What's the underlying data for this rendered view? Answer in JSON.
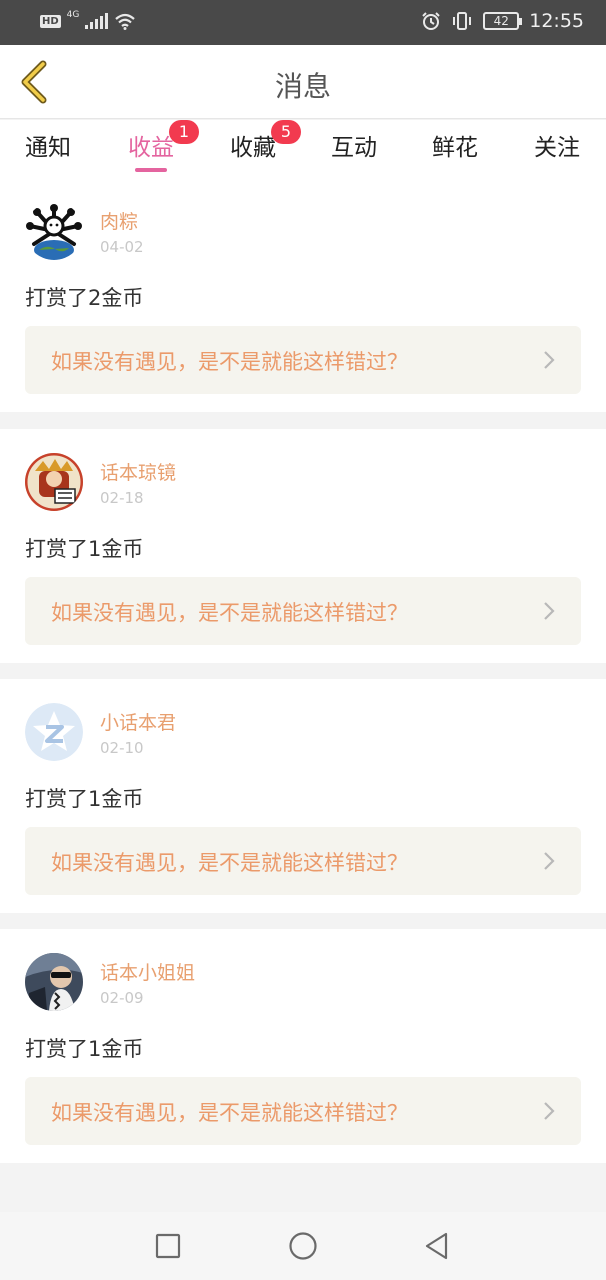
{
  "status_bar": {
    "hd": "HD",
    "network": "4G",
    "battery": "42",
    "time": "12:55"
  },
  "header": {
    "title": "消息",
    "back_icon": "chevron-left-icon"
  },
  "tabs": [
    {
      "label": "通知",
      "active": false,
      "badge": ""
    },
    {
      "label": "收益",
      "active": true,
      "badge": "1"
    },
    {
      "label": "收藏",
      "active": false,
      "badge": "5"
    },
    {
      "label": "互动",
      "active": false,
      "badge": ""
    },
    {
      "label": "鲜花",
      "active": false,
      "badge": ""
    },
    {
      "label": "关注",
      "active": false,
      "badge": ""
    }
  ],
  "messages": [
    {
      "username": "肉粽",
      "date": "04-02",
      "text": "打赏了2金币",
      "quote": "如果没有遇见，是不是就能这样错过？"
    },
    {
      "username": "话本琼镜",
      "date": "02-18",
      "text": "打赏了1金币",
      "quote": "如果没有遇见，是不是就能这样错过？"
    },
    {
      "username": "小话本君",
      "date": "02-10",
      "text": "打赏了1金币",
      "quote": "如果没有遇见，是不是就能这样错过？"
    },
    {
      "username": "话本小姐姐",
      "date": "02-09",
      "text": "打赏了1金币",
      "quote": "如果没有遇见，是不是就能这样错过？"
    }
  ],
  "colors": {
    "accent": "#e4649f",
    "badge": "#f23a4f",
    "username": "#e8a070",
    "quote": "#eb9a6a"
  }
}
